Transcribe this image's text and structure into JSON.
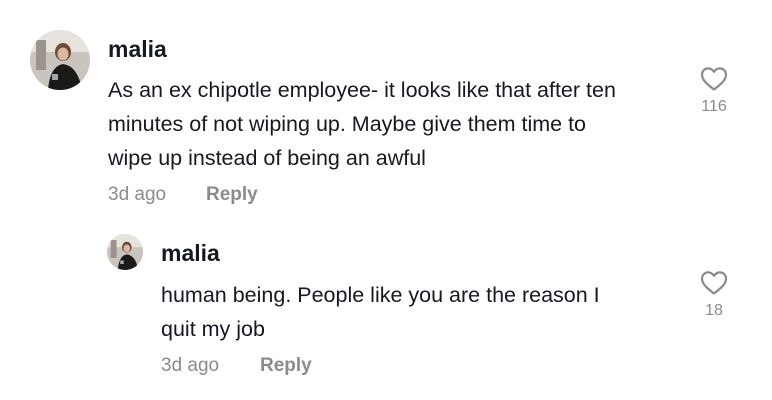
{
  "colors": {
    "text_primary": "#161823",
    "text_secondary": "#8a8b91",
    "background": "#ffffff"
  },
  "comment": {
    "username": "malia",
    "text": "As an ex chipotle employee- it looks like that after ten\nminutes of not wiping up. Maybe give them time to\nwipe up instead of being an awful",
    "timestamp": "3d ago",
    "reply_label": "Reply",
    "like_icon": "heart-outline-icon",
    "like_count": "116"
  },
  "reply": {
    "username": "malia",
    "text": "human being. People like you are the reason I\nquit my job",
    "timestamp": "3d ago",
    "reply_label": "Reply",
    "like_icon": "heart-outline-icon",
    "like_count": "18"
  }
}
